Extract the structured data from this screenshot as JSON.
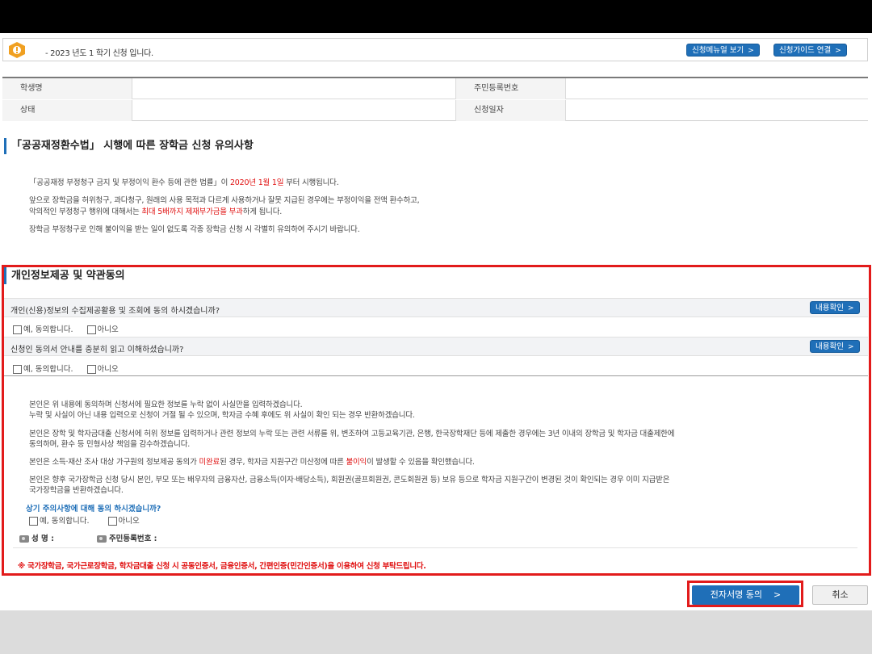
{
  "notice": {
    "text": "- 2023 년도 1 학기 신청 입니다.",
    "manual_button": "신청메뉴얼 보기",
    "guide_button": "신청가이드 연결"
  },
  "info_table": {
    "student_name_label": "학생명",
    "student_name_value": "",
    "resident_no_label": "주민등록번호",
    "resident_no_value": "",
    "status_label": "상태",
    "status_value": "",
    "apply_date_label": "신청일자",
    "apply_date_value": ""
  },
  "notice_section": {
    "title": "「공공재정환수법」 시행에 따른 장학금 신청 유의사항",
    "p1_a": "「공공재정 부정청구 금지 및 부정이익 환수 등에 관한 법률」이 ",
    "p1_red": "2020년 1월 1일",
    "p1_b": " 부터 시행됩니다.",
    "p2_line1": "앞으로 장학금을 허위청구, 과다청구, 원래의 사용 목적과 다르게 사용하거나 잘못 지급된 경우에는 부정이익을 전액 환수하고,",
    "p2_line2_a": "악의적인 부정청구 행위에 대해서는 ",
    "p2_line2_red": "최대 5배까지 제재부가금을 부과",
    "p2_line2_b": "하게 됩니다.",
    "p3": "장학금 부정청구로 인해 불이익을 받는 일이 없도록 각종 장학금 신청 시 각별히 유의하여 주시기 바랍니다."
  },
  "consent": {
    "title": "개인정보제공 및 약관동의",
    "q1": "개인(신용)정보의 수집제공활용 및 조회에 동의 하시겠습니까?",
    "q2": "신청인 동의서 안내를 충분히 읽고 이해하셨습니까?",
    "view_button": "내용확인",
    "agree": "예, 동의합니다.",
    "disagree": "아니오",
    "s1_line1": "본인은 위 내용에 동의하며 신청서에 필요한 정보를 누락 없이 사실만을 입력하겠습니다.",
    "s1_line2": "누락 및 사실이 아닌 내용 입력으로 신청이 거절 될 수 있으며, 학자금 수혜 후에도 위 사실이 확인 되는 경우 반환하겠습니다.",
    "s2_line1": "본인은 장학 및 학자금대출 신청서에 허위 정보를 입력하거나 관련 정보의 누락 또는 관련 서류를 위, 변조하여 고등교육기관, 은행, 한국장학재단 등에 제출한 경우에는 3년 이내의 장학금 및 학자금 대출제한에",
    "s2_line2": "동의하며, 환수 등 민형사상 책임을 감수하겠습니다.",
    "s3_a": "본인은 소득·재산 조사 대상 가구원의 정보제공 동의가 ",
    "s3_red1": "미완료",
    "s3_b": "된 경우, 학자금 지원구간 미산정에 따른 ",
    "s3_red2": "불이익",
    "s3_c": "이 발생할 수 있음을 확인했습니다.",
    "s4_line1": "본인은 향후 국가장학금 신청 당시 본인, 부모 또는 배우자의 금융자산, 금융소득(이자·배당소득), 회원권(골프회원권, 콘도회원권 등) 보유 등으로 학자금 지원구간이 변경된 것이 확인되는 경우 이미 지급받은",
    "s4_line2": "국가장학금을 반환하겠습니다.",
    "question3": "상기 주의사항에 대해 동의 하시겠습니까?",
    "agree2": "예, 동의합니다.",
    "disagree2": "아니오",
    "name_label": "성 명 :",
    "resident_label": "주민등록번호 :",
    "warning": "※ 국가장학금, 국가근로장학금, 학자금대출 신청 시 공동인증서, 금융인증서, 간편인증(민간인증서)을 이용하여 신청 부탁드립니다."
  },
  "actions": {
    "esign_label": "전자서명 동의",
    "cancel_label": "취소"
  },
  "colors": {
    "accent": "#1f6fb8",
    "warning": "#e01010",
    "highlight_frame": "#e21b1b"
  }
}
